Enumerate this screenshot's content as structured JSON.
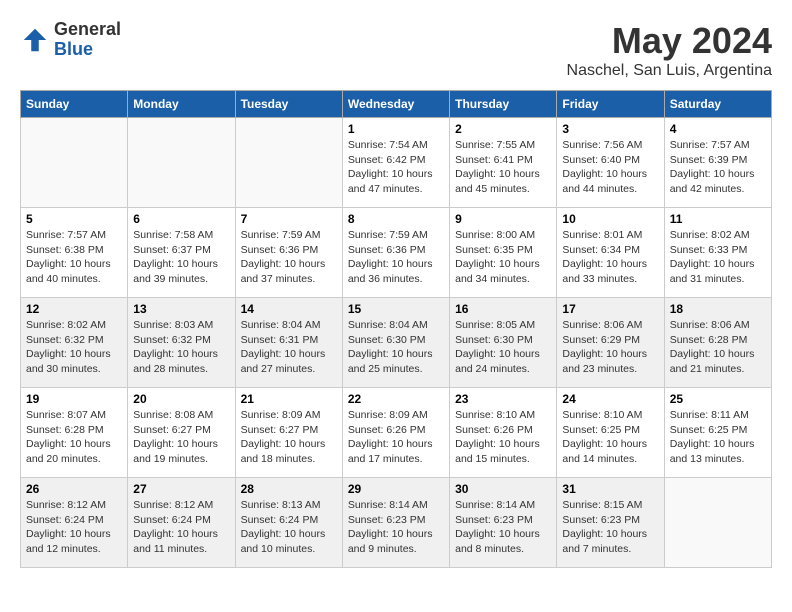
{
  "logo": {
    "general": "General",
    "blue": "Blue"
  },
  "title": "May 2024",
  "subtitle": "Naschel, San Luis, Argentina",
  "days_of_week": [
    "Sunday",
    "Monday",
    "Tuesday",
    "Wednesday",
    "Thursday",
    "Friday",
    "Saturday"
  ],
  "weeks": [
    [
      {
        "day": "",
        "info": ""
      },
      {
        "day": "",
        "info": ""
      },
      {
        "day": "",
        "info": ""
      },
      {
        "day": "1",
        "info": "Sunrise: 7:54 AM\nSunset: 6:42 PM\nDaylight: 10 hours\nand 47 minutes."
      },
      {
        "day": "2",
        "info": "Sunrise: 7:55 AM\nSunset: 6:41 PM\nDaylight: 10 hours\nand 45 minutes."
      },
      {
        "day": "3",
        "info": "Sunrise: 7:56 AM\nSunset: 6:40 PM\nDaylight: 10 hours\nand 44 minutes."
      },
      {
        "day": "4",
        "info": "Sunrise: 7:57 AM\nSunset: 6:39 PM\nDaylight: 10 hours\nand 42 minutes."
      }
    ],
    [
      {
        "day": "5",
        "info": "Sunrise: 7:57 AM\nSunset: 6:38 PM\nDaylight: 10 hours\nand 40 minutes."
      },
      {
        "day": "6",
        "info": "Sunrise: 7:58 AM\nSunset: 6:37 PM\nDaylight: 10 hours\nand 39 minutes."
      },
      {
        "day": "7",
        "info": "Sunrise: 7:59 AM\nSunset: 6:36 PM\nDaylight: 10 hours\nand 37 minutes."
      },
      {
        "day": "8",
        "info": "Sunrise: 7:59 AM\nSunset: 6:36 PM\nDaylight: 10 hours\nand 36 minutes."
      },
      {
        "day": "9",
        "info": "Sunrise: 8:00 AM\nSunset: 6:35 PM\nDaylight: 10 hours\nand 34 minutes."
      },
      {
        "day": "10",
        "info": "Sunrise: 8:01 AM\nSunset: 6:34 PM\nDaylight: 10 hours\nand 33 minutes."
      },
      {
        "day": "11",
        "info": "Sunrise: 8:02 AM\nSunset: 6:33 PM\nDaylight: 10 hours\nand 31 minutes."
      }
    ],
    [
      {
        "day": "12",
        "info": "Sunrise: 8:02 AM\nSunset: 6:32 PM\nDaylight: 10 hours\nand 30 minutes."
      },
      {
        "day": "13",
        "info": "Sunrise: 8:03 AM\nSunset: 6:32 PM\nDaylight: 10 hours\nand 28 minutes."
      },
      {
        "day": "14",
        "info": "Sunrise: 8:04 AM\nSunset: 6:31 PM\nDaylight: 10 hours\nand 27 minutes."
      },
      {
        "day": "15",
        "info": "Sunrise: 8:04 AM\nSunset: 6:30 PM\nDaylight: 10 hours\nand 25 minutes."
      },
      {
        "day": "16",
        "info": "Sunrise: 8:05 AM\nSunset: 6:30 PM\nDaylight: 10 hours\nand 24 minutes."
      },
      {
        "day": "17",
        "info": "Sunrise: 8:06 AM\nSunset: 6:29 PM\nDaylight: 10 hours\nand 23 minutes."
      },
      {
        "day": "18",
        "info": "Sunrise: 8:06 AM\nSunset: 6:28 PM\nDaylight: 10 hours\nand 21 minutes."
      }
    ],
    [
      {
        "day": "19",
        "info": "Sunrise: 8:07 AM\nSunset: 6:28 PM\nDaylight: 10 hours\nand 20 minutes."
      },
      {
        "day": "20",
        "info": "Sunrise: 8:08 AM\nSunset: 6:27 PM\nDaylight: 10 hours\nand 19 minutes."
      },
      {
        "day": "21",
        "info": "Sunrise: 8:09 AM\nSunset: 6:27 PM\nDaylight: 10 hours\nand 18 minutes."
      },
      {
        "day": "22",
        "info": "Sunrise: 8:09 AM\nSunset: 6:26 PM\nDaylight: 10 hours\nand 17 minutes."
      },
      {
        "day": "23",
        "info": "Sunrise: 8:10 AM\nSunset: 6:26 PM\nDaylight: 10 hours\nand 15 minutes."
      },
      {
        "day": "24",
        "info": "Sunrise: 8:10 AM\nSunset: 6:25 PM\nDaylight: 10 hours\nand 14 minutes."
      },
      {
        "day": "25",
        "info": "Sunrise: 8:11 AM\nSunset: 6:25 PM\nDaylight: 10 hours\nand 13 minutes."
      }
    ],
    [
      {
        "day": "26",
        "info": "Sunrise: 8:12 AM\nSunset: 6:24 PM\nDaylight: 10 hours\nand 12 minutes."
      },
      {
        "day": "27",
        "info": "Sunrise: 8:12 AM\nSunset: 6:24 PM\nDaylight: 10 hours\nand 11 minutes."
      },
      {
        "day": "28",
        "info": "Sunrise: 8:13 AM\nSunset: 6:24 PM\nDaylight: 10 hours\nand 10 minutes."
      },
      {
        "day": "29",
        "info": "Sunrise: 8:14 AM\nSunset: 6:23 PM\nDaylight: 10 hours\nand 9 minutes."
      },
      {
        "day": "30",
        "info": "Sunrise: 8:14 AM\nSunset: 6:23 PM\nDaylight: 10 hours\nand 8 minutes."
      },
      {
        "day": "31",
        "info": "Sunrise: 8:15 AM\nSunset: 6:23 PM\nDaylight: 10 hours\nand 7 minutes."
      },
      {
        "day": "",
        "info": ""
      }
    ]
  ]
}
